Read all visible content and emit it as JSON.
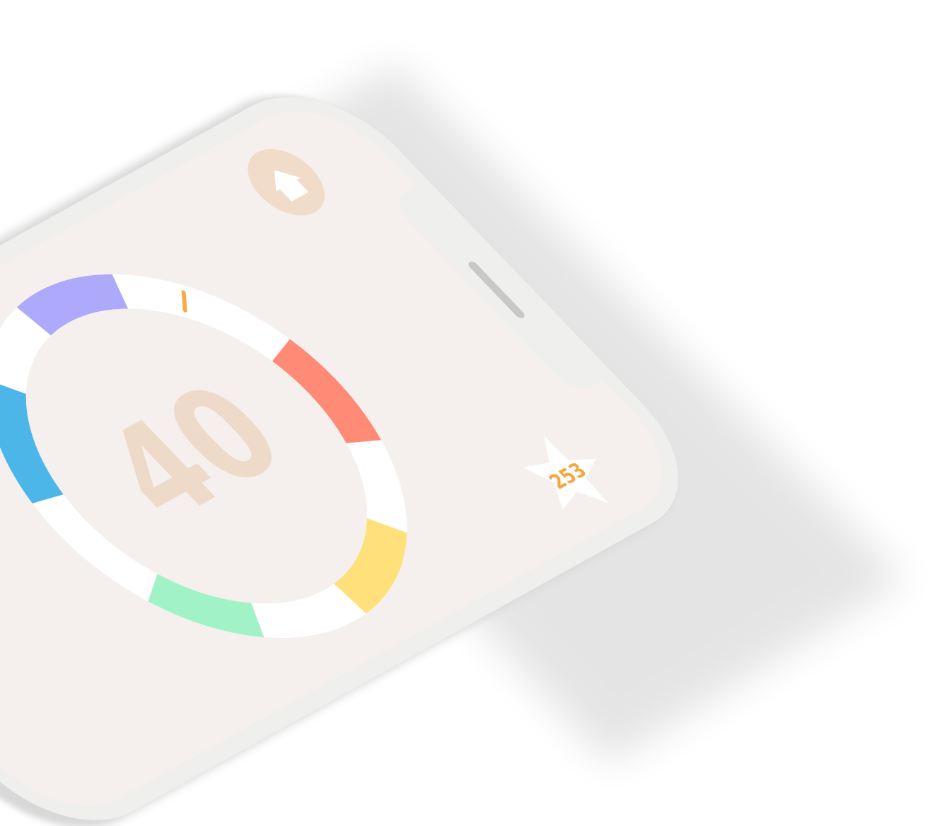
{
  "game": {
    "score": "40",
    "star_count": "253"
  },
  "home_button": {
    "icon": "home-icon"
  },
  "star_badge": {
    "icon": "star-icon"
  },
  "ring": {
    "segments": [
      {
        "name": "red",
        "color": "#FF8A75"
      },
      {
        "name": "yellow",
        "color": "#FFE07A"
      },
      {
        "name": "green",
        "color": "#A2F2C8"
      },
      {
        "name": "blue",
        "color": "#4DB6E8"
      },
      {
        "name": "purple",
        "color": "#ADA9FB"
      }
    ],
    "gap_color": "#FFFFFF",
    "marker_color": "#F8A94A"
  },
  "colors": {
    "screen_bg": "#F5F0ED",
    "device_body": "#EFEFEE",
    "score_color": "#EEDAC8",
    "home_button_bg": "#F0DCC8",
    "star_number": "#F6A742",
    "home_indicator": "#1E1E1E"
  }
}
